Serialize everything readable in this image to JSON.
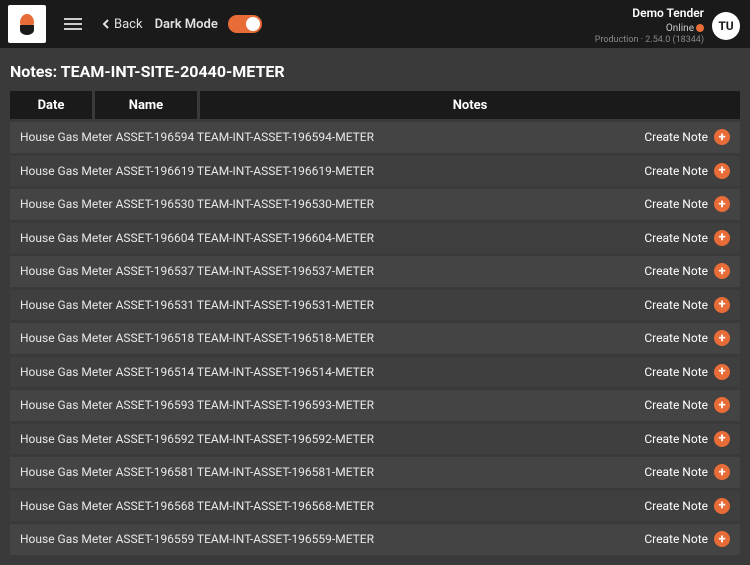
{
  "header": {
    "back_label": "Back",
    "dark_mode_label": "Dark Mode",
    "user_name": "Demo Tender",
    "online_label": "Online",
    "version_prefix": "Production",
    "version": "2.54.0 (18344)",
    "avatar_initials": "TU"
  },
  "page": {
    "title": "Notes: TEAM-INT-SITE-20440-METER"
  },
  "columns": {
    "date": "Date",
    "name": "Name",
    "notes": "Notes"
  },
  "create_note_label": "Create Note",
  "rows": [
    {
      "text": "House Gas Meter ASSET-196594 TEAM-INT-ASSET-196594-METER"
    },
    {
      "text": "House Gas Meter ASSET-196619 TEAM-INT-ASSET-196619-METER"
    },
    {
      "text": "House Gas Meter ASSET-196530 TEAM-INT-ASSET-196530-METER"
    },
    {
      "text": "House Gas Meter ASSET-196604 TEAM-INT-ASSET-196604-METER"
    },
    {
      "text": "House Gas Meter ASSET-196537 TEAM-INT-ASSET-196537-METER"
    },
    {
      "text": "House Gas Meter ASSET-196531 TEAM-INT-ASSET-196531-METER"
    },
    {
      "text": "House Gas Meter ASSET-196518 TEAM-INT-ASSET-196518-METER"
    },
    {
      "text": "House Gas Meter ASSET-196514 TEAM-INT-ASSET-196514-METER"
    },
    {
      "text": "House Gas Meter ASSET-196593 TEAM-INT-ASSET-196593-METER"
    },
    {
      "text": "House Gas Meter ASSET-196592 TEAM-INT-ASSET-196592-METER"
    },
    {
      "text": "House Gas Meter ASSET-196581 TEAM-INT-ASSET-196581-METER"
    },
    {
      "text": "House Gas Meter ASSET-196568 TEAM-INT-ASSET-196568-METER"
    },
    {
      "text": "House Gas Meter ASSET-196559 TEAM-INT-ASSET-196559-METER"
    }
  ]
}
